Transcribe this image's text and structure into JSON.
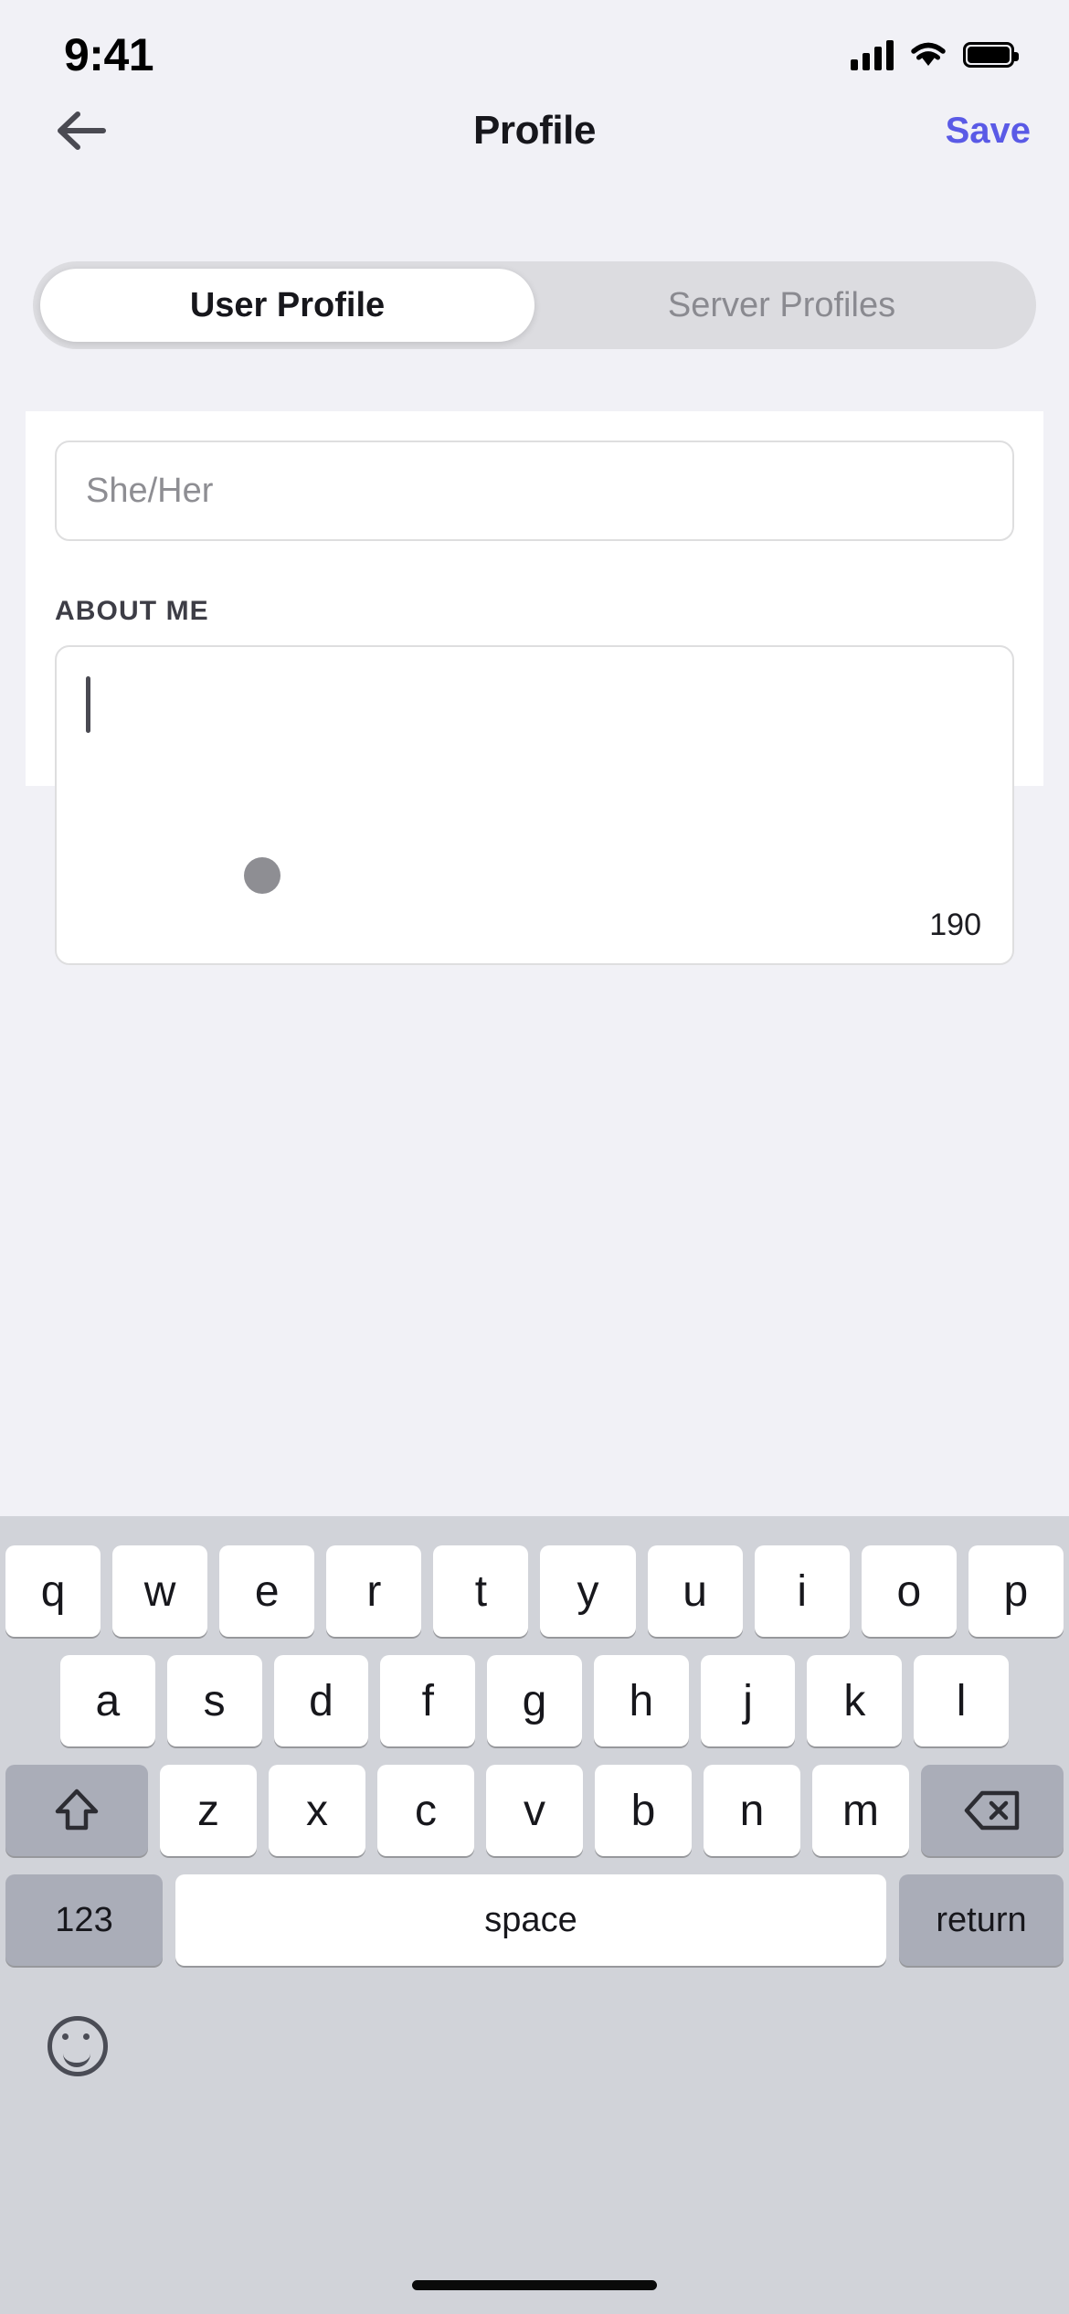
{
  "status_bar": {
    "time": "9:41",
    "cellular_icon": "cellular-bars-icon",
    "wifi_icon": "wifi-icon",
    "battery_icon": "battery-full-icon"
  },
  "nav": {
    "back_icon": "arrow-left-icon",
    "title": "Profile",
    "save_label": "Save",
    "save_color": "#5a5ae6"
  },
  "tabs": [
    {
      "label": "User Profile",
      "active": true
    },
    {
      "label": "Server Profiles",
      "active": false
    }
  ],
  "form": {
    "pronouns": {
      "value": "",
      "placeholder": "She/Her"
    },
    "about": {
      "label": "ABOUT ME",
      "value": "",
      "char_counter": "190",
      "caret_visible": true
    }
  },
  "drag_handle": {
    "name": "sheet-drag-handle",
    "color": "#8e8e93"
  },
  "keyboard": {
    "row1": [
      "q",
      "w",
      "e",
      "r",
      "t",
      "y",
      "u",
      "i",
      "o",
      "p"
    ],
    "row2": [
      "a",
      "s",
      "d",
      "f",
      "g",
      "h",
      "j",
      "k",
      "l"
    ],
    "row3_letters": [
      "z",
      "x",
      "c",
      "v",
      "b",
      "n",
      "m"
    ],
    "shift_icon": "shift-arrow-up-icon",
    "backspace_icon": "backspace-delete-icon",
    "shift_label": "⇧",
    "backspace_label": "⌫",
    "numbers_label": "123",
    "space_label": "space",
    "return_label": "return",
    "emoji_icon": "emoji-smiley-icon"
  }
}
